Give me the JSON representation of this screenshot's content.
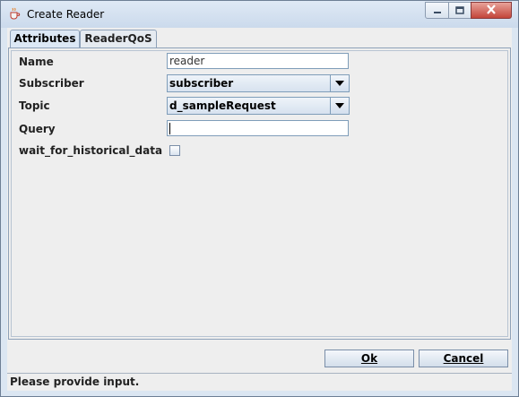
{
  "window": {
    "title": "Create Reader"
  },
  "tabs": [
    {
      "label": "Attributes",
      "active": true
    },
    {
      "label": "ReaderQoS",
      "active": false
    }
  ],
  "form": {
    "name": {
      "label": "Name",
      "value": "reader"
    },
    "subscriber": {
      "label": "Subscriber",
      "value": "subscriber"
    },
    "topic": {
      "label": "Topic",
      "value": "d_sampleRequest"
    },
    "query": {
      "label": "Query",
      "value": ""
    },
    "wait_for_historical_data": {
      "label": "wait_for_historical_data",
      "checked": false
    }
  },
  "buttons": {
    "ok": "Ok",
    "cancel": "Cancel"
  },
  "status": "Please provide input.",
  "icons": {
    "app": "java-cup-icon",
    "minimize": "minimize-icon",
    "maximize": "maximize-icon",
    "close": "close-icon",
    "dropdown": "chevron-down-icon"
  }
}
